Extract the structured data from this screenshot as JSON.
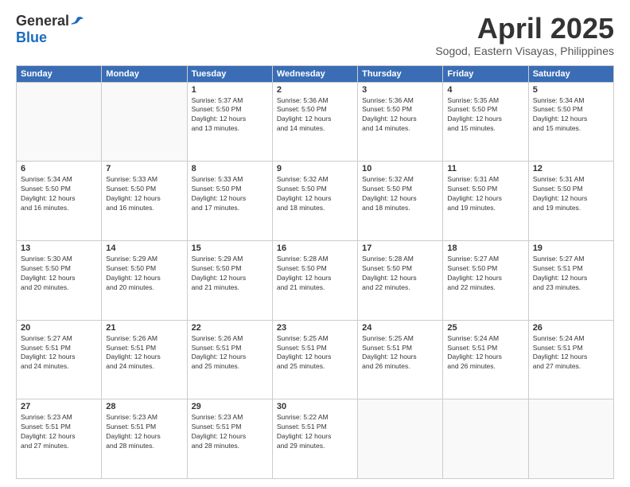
{
  "logo": {
    "general": "General",
    "blue": "Blue"
  },
  "header": {
    "title": "April 2025",
    "subtitle": "Sogod, Eastern Visayas, Philippines"
  },
  "days_of_week": [
    "Sunday",
    "Monday",
    "Tuesday",
    "Wednesday",
    "Thursday",
    "Friday",
    "Saturday"
  ],
  "weeks": [
    [
      {
        "day": "",
        "info": ""
      },
      {
        "day": "",
        "info": ""
      },
      {
        "day": "1",
        "info": "Sunrise: 5:37 AM\nSunset: 5:50 PM\nDaylight: 12 hours\nand 13 minutes."
      },
      {
        "day": "2",
        "info": "Sunrise: 5:36 AM\nSunset: 5:50 PM\nDaylight: 12 hours\nand 14 minutes."
      },
      {
        "day": "3",
        "info": "Sunrise: 5:36 AM\nSunset: 5:50 PM\nDaylight: 12 hours\nand 14 minutes."
      },
      {
        "day": "4",
        "info": "Sunrise: 5:35 AM\nSunset: 5:50 PM\nDaylight: 12 hours\nand 15 minutes."
      },
      {
        "day": "5",
        "info": "Sunrise: 5:34 AM\nSunset: 5:50 PM\nDaylight: 12 hours\nand 15 minutes."
      }
    ],
    [
      {
        "day": "6",
        "info": "Sunrise: 5:34 AM\nSunset: 5:50 PM\nDaylight: 12 hours\nand 16 minutes."
      },
      {
        "day": "7",
        "info": "Sunrise: 5:33 AM\nSunset: 5:50 PM\nDaylight: 12 hours\nand 16 minutes."
      },
      {
        "day": "8",
        "info": "Sunrise: 5:33 AM\nSunset: 5:50 PM\nDaylight: 12 hours\nand 17 minutes."
      },
      {
        "day": "9",
        "info": "Sunrise: 5:32 AM\nSunset: 5:50 PM\nDaylight: 12 hours\nand 18 minutes."
      },
      {
        "day": "10",
        "info": "Sunrise: 5:32 AM\nSunset: 5:50 PM\nDaylight: 12 hours\nand 18 minutes."
      },
      {
        "day": "11",
        "info": "Sunrise: 5:31 AM\nSunset: 5:50 PM\nDaylight: 12 hours\nand 19 minutes."
      },
      {
        "day": "12",
        "info": "Sunrise: 5:31 AM\nSunset: 5:50 PM\nDaylight: 12 hours\nand 19 minutes."
      }
    ],
    [
      {
        "day": "13",
        "info": "Sunrise: 5:30 AM\nSunset: 5:50 PM\nDaylight: 12 hours\nand 20 minutes."
      },
      {
        "day": "14",
        "info": "Sunrise: 5:29 AM\nSunset: 5:50 PM\nDaylight: 12 hours\nand 20 minutes."
      },
      {
        "day": "15",
        "info": "Sunrise: 5:29 AM\nSunset: 5:50 PM\nDaylight: 12 hours\nand 21 minutes."
      },
      {
        "day": "16",
        "info": "Sunrise: 5:28 AM\nSunset: 5:50 PM\nDaylight: 12 hours\nand 21 minutes."
      },
      {
        "day": "17",
        "info": "Sunrise: 5:28 AM\nSunset: 5:50 PM\nDaylight: 12 hours\nand 22 minutes."
      },
      {
        "day": "18",
        "info": "Sunrise: 5:27 AM\nSunset: 5:50 PM\nDaylight: 12 hours\nand 22 minutes."
      },
      {
        "day": "19",
        "info": "Sunrise: 5:27 AM\nSunset: 5:51 PM\nDaylight: 12 hours\nand 23 minutes."
      }
    ],
    [
      {
        "day": "20",
        "info": "Sunrise: 5:27 AM\nSunset: 5:51 PM\nDaylight: 12 hours\nand 24 minutes."
      },
      {
        "day": "21",
        "info": "Sunrise: 5:26 AM\nSunset: 5:51 PM\nDaylight: 12 hours\nand 24 minutes."
      },
      {
        "day": "22",
        "info": "Sunrise: 5:26 AM\nSunset: 5:51 PM\nDaylight: 12 hours\nand 25 minutes."
      },
      {
        "day": "23",
        "info": "Sunrise: 5:25 AM\nSunset: 5:51 PM\nDaylight: 12 hours\nand 25 minutes."
      },
      {
        "day": "24",
        "info": "Sunrise: 5:25 AM\nSunset: 5:51 PM\nDaylight: 12 hours\nand 26 minutes."
      },
      {
        "day": "25",
        "info": "Sunrise: 5:24 AM\nSunset: 5:51 PM\nDaylight: 12 hours\nand 26 minutes."
      },
      {
        "day": "26",
        "info": "Sunrise: 5:24 AM\nSunset: 5:51 PM\nDaylight: 12 hours\nand 27 minutes."
      }
    ],
    [
      {
        "day": "27",
        "info": "Sunrise: 5:23 AM\nSunset: 5:51 PM\nDaylight: 12 hours\nand 27 minutes."
      },
      {
        "day": "28",
        "info": "Sunrise: 5:23 AM\nSunset: 5:51 PM\nDaylight: 12 hours\nand 28 minutes."
      },
      {
        "day": "29",
        "info": "Sunrise: 5:23 AM\nSunset: 5:51 PM\nDaylight: 12 hours\nand 28 minutes."
      },
      {
        "day": "30",
        "info": "Sunrise: 5:22 AM\nSunset: 5:51 PM\nDaylight: 12 hours\nand 29 minutes."
      },
      {
        "day": "",
        "info": ""
      },
      {
        "day": "",
        "info": ""
      },
      {
        "day": "",
        "info": ""
      }
    ]
  ]
}
